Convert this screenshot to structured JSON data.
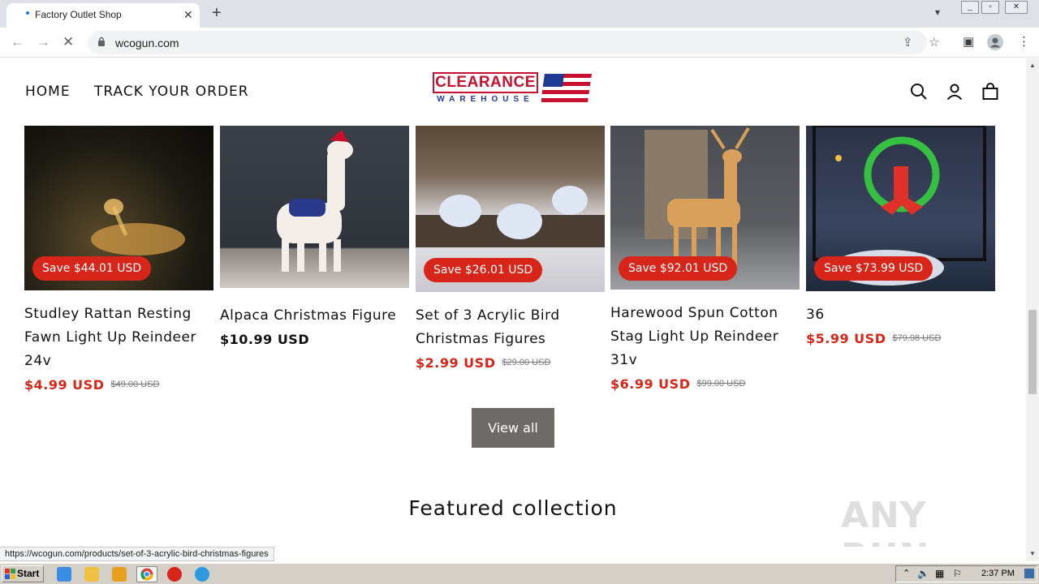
{
  "browser": {
    "tab_title": "Factory Outlet Shop",
    "url": "wcogun.com",
    "status_url": "https://wcogun.com/products/set-of-3-acrylic-bird-christmas-figures"
  },
  "header": {
    "nav": [
      "HOME",
      "TRACK YOUR ORDER"
    ],
    "logo_top": "CLEARANCE",
    "logo_bottom": "WAREHOUSE"
  },
  "products": [
    {
      "title": "Studley Rattan Resting Fawn Light Up Reindeer 24v",
      "badge": "Save $44.01 USD",
      "price": "$4.99 USD",
      "compare": "$49.00 USD"
    },
    {
      "title": "Alpaca Christmas Figure",
      "badge": "",
      "price": "$10.99 USD",
      "compare": ""
    },
    {
      "title": "Set of 3 Acrylic Bird Christmas Figures",
      "badge": "Save $26.01 USD",
      "price": "$2.99 USD",
      "compare": "$29.00 USD"
    },
    {
      "title": "Harewood Spun Cotton Stag Light Up Reindeer 31v",
      "badge": "Save $92.01 USD",
      "price": "$6.99 USD",
      "compare": "$99.00 USD"
    },
    {
      "title": "36",
      "badge": "Save $73.99 USD",
      "price": "$5.99 USD",
      "compare": "$79.98 USD"
    }
  ],
  "view_all_label": "View all",
  "featured_heading": "Featured collection",
  "watermark": "ANY RUN",
  "taskbar": {
    "start_label": "Start",
    "clock": "2:37 PM"
  },
  "colors": {
    "sale_red": "#d8251a",
    "button_gray": "#6e6a67"
  }
}
